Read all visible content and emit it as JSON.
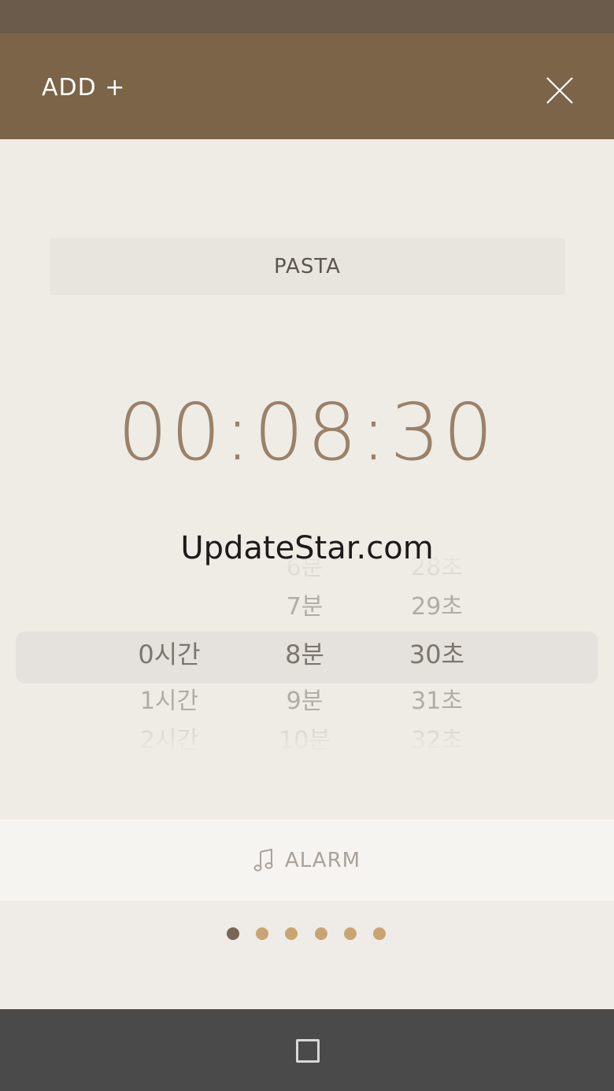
{
  "header": {
    "title": "ADD +",
    "close_icon": "close-icon"
  },
  "timer_name": {
    "value": "PASTA"
  },
  "time_display": {
    "value": "00:08:30"
  },
  "watermark": {
    "text": "UpdateStar.com"
  },
  "picker": {
    "hours": [
      "0시간",
      "1시간",
      "2시간"
    ],
    "minutes": [
      "6분",
      "7분",
      "8분",
      "9분",
      "10분"
    ],
    "seconds": [
      "28초",
      "29초",
      "30초",
      "31초",
      "32초"
    ],
    "selected": {
      "hours": "0시간",
      "minutes": "8분",
      "seconds": "30초"
    }
  },
  "alarm": {
    "icon": "music-note-icon",
    "label": "ALARM"
  },
  "pager": {
    "count": 6,
    "active_index": 0,
    "active_color": "#7a6654",
    "inactive_color": "#c9a472"
  },
  "colors": {
    "header": "#7b6447",
    "status_bar": "#6a5b4b",
    "time_text": "#9a8169",
    "nav_bar": "#4a4a4a"
  },
  "nav_bar": {
    "icon": "overview-square-icon"
  }
}
